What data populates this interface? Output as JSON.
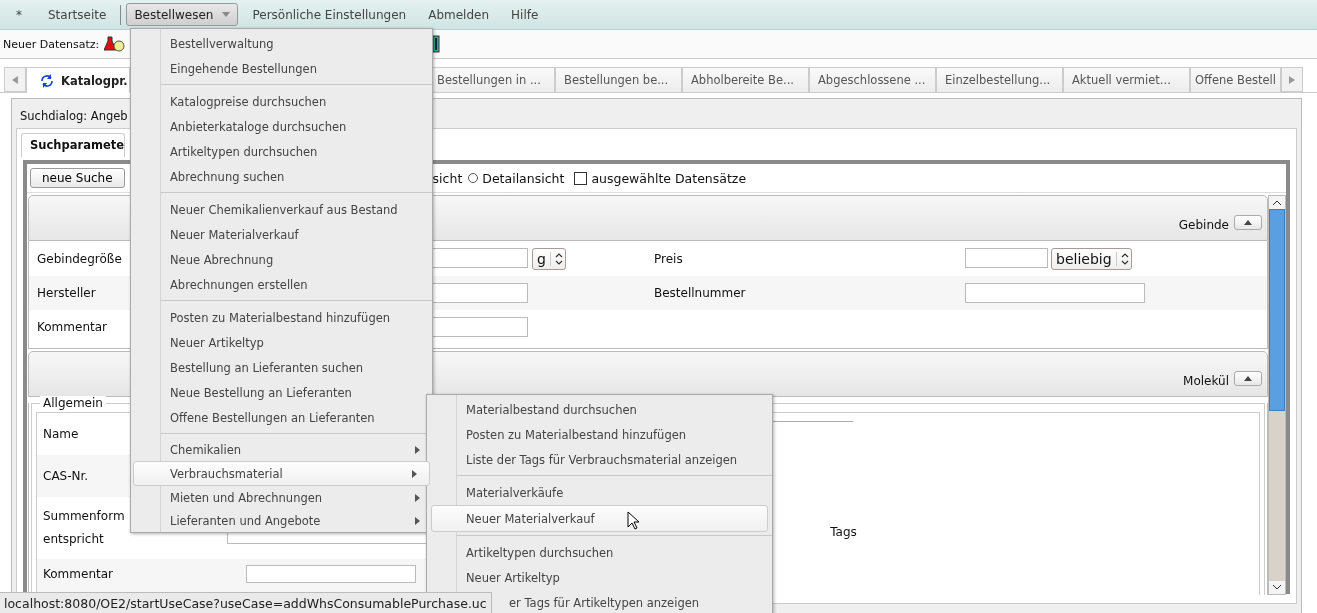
{
  "menubar": [
    {
      "label": "*",
      "kind": "item",
      "selected": false
    },
    {
      "label": "Startseite",
      "kind": "item",
      "selected": false
    },
    {
      "label": "Bestellwesen",
      "kind": "dropdown",
      "selected": true
    },
    {
      "label": "Persönliche Einstellungen",
      "kind": "item",
      "selected": false
    },
    {
      "label": "Abmelden",
      "kind": "item",
      "selected": false
    },
    {
      "label": "Hilfe",
      "kind": "item",
      "selected": false
    }
  ],
  "toolbar": {
    "label": "Neuer Datensatz:"
  },
  "tabs": [
    {
      "label": "Katalogpr.",
      "selected": true,
      "loading": true
    },
    {
      "label": "Bestellungen in ...",
      "selected": false,
      "loading": false
    },
    {
      "label": "Bestellungen be...",
      "selected": false,
      "loading": false
    },
    {
      "label": "Abholbereite Be...",
      "selected": false,
      "loading": false
    },
    {
      "label": "Abgeschlossene ...",
      "selected": false,
      "loading": false
    },
    {
      "label": "Einzelbestellung...",
      "selected": false,
      "loading": false
    },
    {
      "label": "Aktuell vermiet...",
      "selected": false,
      "loading": false
    },
    {
      "label": "Offene Bestell",
      "selected": false,
      "loading": false
    }
  ],
  "search_dialog": {
    "title": "Suchdialog: Angeb",
    "tab": "Suchparamete",
    "new_search_button": "neue Suche",
    "view_options": [
      {
        "kind": "text",
        "label": "sicht"
      },
      {
        "kind": "radio",
        "label": "Detailansicht",
        "selected": false
      },
      {
        "kind": "checkbox",
        "label": "ausgewählte Datensätze",
        "checked": false
      }
    ]
  },
  "container_section": {
    "title": "Gebinde",
    "expanded": true,
    "rows": [
      {
        "label": "Gebindegröße",
        "fields": [
          {
            "kind": "input"
          },
          {
            "kind": "select",
            "value": "g"
          }
        ],
        "label2": "Preis",
        "fields2": [
          {
            "kind": "input"
          },
          {
            "kind": "select",
            "value": "beliebig"
          }
        ]
      },
      {
        "label": "Hersteller",
        "fields": [
          {
            "kind": "input"
          }
        ],
        "label2": "Bestellnummer",
        "fields2": [
          {
            "kind": "input"
          }
        ]
      },
      {
        "label": "Kommentar",
        "fields": [
          {
            "kind": "input"
          }
        ],
        "label2": "",
        "fields2": []
      }
    ]
  },
  "molecule_section": {
    "title": "Molekül",
    "expanded": true,
    "group_title": "Allgemein",
    "rows": [
      {
        "label": "Name",
        "fields": []
      },
      {
        "label": "CAS-Nr.",
        "fields": []
      },
      {
        "label": "Summenform entspricht",
        "fields": [
          {
            "kind": "input"
          }
        ]
      },
      {
        "label": "Kommentar",
        "fields": [
          {
            "kind": "input"
          }
        ]
      }
    ],
    "tags_label": "Tags"
  },
  "dropdown_menu": {
    "groups": [
      [
        {
          "label": "Bestellverwaltung",
          "kind": "action",
          "selected": false
        },
        {
          "label": "Eingehende Bestellungen",
          "kind": "action",
          "selected": false
        }
      ],
      [
        {
          "label": "Katalogpreise durchsuchen",
          "kind": "action",
          "selected": false
        },
        {
          "label": "Anbieterkataloge durchsuchen",
          "kind": "action",
          "selected": false
        },
        {
          "label": "Artikeltypen durchsuchen",
          "kind": "action",
          "selected": false
        },
        {
          "label": "Abrechnung suchen",
          "kind": "action",
          "selected": false
        }
      ],
      [
        {
          "label": "Neuer Chemikalienverkauf aus Bestand",
          "kind": "action",
          "selected": false
        },
        {
          "label": "Neuer Materialverkauf",
          "kind": "action",
          "selected": false
        },
        {
          "label": "Neue Abrechnung",
          "kind": "action",
          "selected": false
        },
        {
          "label": "Abrechnungen erstellen",
          "kind": "action",
          "selected": false
        }
      ],
      [
        {
          "label": "Posten zu Materialbestand hinzufügen",
          "kind": "action",
          "selected": false
        },
        {
          "label": "Neuer Artikeltyp",
          "kind": "action",
          "selected": false
        },
        {
          "label": "Bestellung an Lieferanten suchen",
          "kind": "action",
          "selected": false
        },
        {
          "label": "Neue Bestellung an Lieferanten",
          "kind": "action",
          "selected": false
        },
        {
          "label": "Offene Bestellungen an Lieferanten",
          "kind": "action",
          "selected": false
        }
      ],
      [
        {
          "label": "Chemikalien",
          "kind": "submenu",
          "selected": false
        },
        {
          "label": "Verbrauchsmaterial",
          "kind": "submenu",
          "selected": true
        },
        {
          "label": "Mieten und Abrechnungen",
          "kind": "submenu",
          "selected": false
        },
        {
          "label": "Lieferanten und Angebote",
          "kind": "submenu",
          "selected": false
        }
      ]
    ]
  },
  "submenu": {
    "groups": [
      [
        {
          "label": "Materialbestand durchsuchen",
          "selected": false,
          "clipped": false
        },
        {
          "label": "Posten zu Materialbestand hinzufügen",
          "selected": false,
          "clipped": false
        },
        {
          "label": "Liste der Tags für Verbrauchsmaterial anzeigen",
          "selected": false,
          "clipped": false
        }
      ],
      [
        {
          "label": "Materialverkäufe",
          "selected": false,
          "clipped": false
        },
        {
          "label": "Neuer Materialverkauf",
          "selected": true,
          "clipped": false
        }
      ],
      [
        {
          "label": "Artikeltypen durchsuchen",
          "selected": false,
          "clipped": false
        },
        {
          "label": "Neuer Artikeltyp",
          "selected": false,
          "clipped": false
        },
        {
          "label": "er Tags für Artikeltypen anzeigen",
          "selected": false,
          "clipped": true
        }
      ]
    ]
  },
  "status_bar": {
    "url": "localhost:8080/OE2/startUseCase?useCase=addWhsConsumablePurchase.uc"
  }
}
